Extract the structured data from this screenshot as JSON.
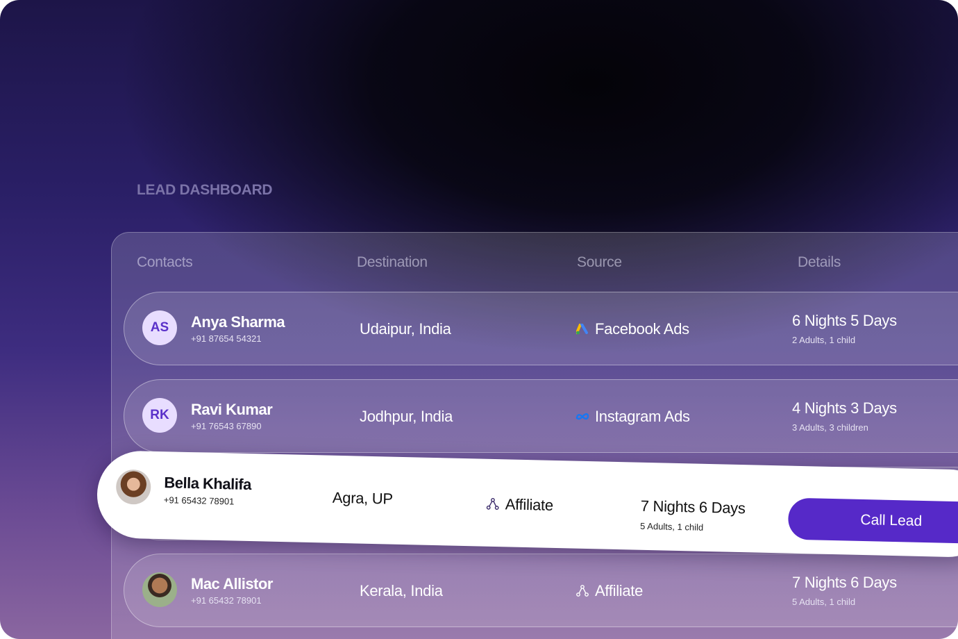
{
  "dashboard": {
    "title": "LEAD DASHBOARD"
  },
  "columns": {
    "contacts": "Contacts",
    "destination": "Destination",
    "source": "Source",
    "details": "Details"
  },
  "leads": [
    {
      "initials": "AS",
      "name": "Anya Sharma",
      "phone": "+91 87654 54321",
      "destination": "Udaipur, India",
      "source": "Facebook Ads",
      "source_icon": "google-ads-icon",
      "nights": "6 Nights 5 Days",
      "guests": "2 Adults, 1 child"
    },
    {
      "initials": "RK",
      "name": "Ravi Kumar",
      "phone": "+91 76543 67890",
      "destination": "Jodhpur, India",
      "source": "Instagram Ads",
      "source_icon": "meta-icon",
      "nights": "4 Nights 3 Days",
      "guests": "3 Adults, 3 children"
    },
    {
      "initials": "",
      "name": "Mac Allistor",
      "phone": "+91 65432 78901",
      "destination": "Kerala, India",
      "source": "Affiliate",
      "source_icon": "affiliate-network-icon",
      "nights": "7 Nights 6 Days",
      "guests": "5 Adults, 1 child"
    }
  ],
  "highlighted": {
    "name": "Bella Khalifa",
    "phone": "+91 65432 78901",
    "destination": "Agra, UP",
    "source": "Affiliate",
    "source_icon": "affiliate-network-icon",
    "nights": "7 Nights 6 Days",
    "guests": "5 Adults, 1 child",
    "action_label": "Call Lead"
  },
  "colors": {
    "accent": "#5629c8",
    "avatar_bg": "#e8ddff",
    "avatar_text": "#5a31c9"
  }
}
